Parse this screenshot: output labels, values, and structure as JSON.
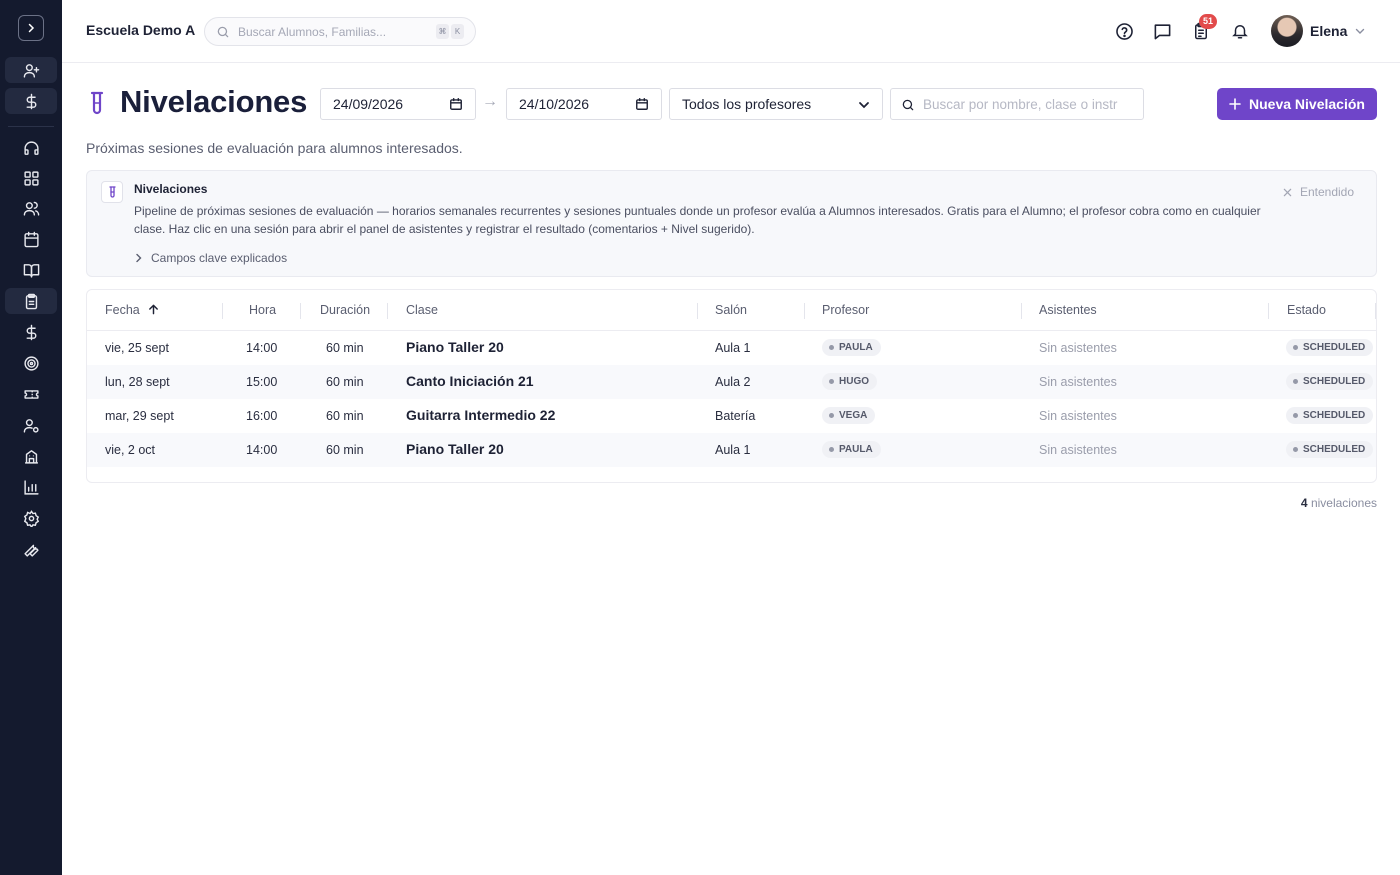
{
  "app": {
    "school_name": "Escuela Demo A",
    "search_placeholder": "Buscar Alumnos, Familias...",
    "shortcut_keys": [
      "⌘",
      "K"
    ],
    "notifications_badge": "51",
    "user_name": "Elena"
  },
  "sidebar": {
    "icons": [
      "user-plus-icon",
      "dollar-icon",
      "headset-icon",
      "grid-icon",
      "users-icon",
      "calendar-icon",
      "book-icon",
      "clipboard-icon",
      "dollar-icon",
      "target-icon",
      "ticket-icon",
      "user-gear-icon",
      "building-icon",
      "chart-icon",
      "settings-icon",
      "wrench-icon"
    ],
    "active": "clipboard-icon"
  },
  "page": {
    "title": "Nivelaciones",
    "subtitle": "Próximas sesiones de evaluación para alumnos interesados.",
    "date_from": "24/09/2026",
    "date_to": "24/10/2026",
    "date_separator": "→",
    "teacher_filter": "Todos los profesores",
    "search_placeholder": "Buscar por nombre, clase o instr",
    "new_button": "Nueva Nivelación"
  },
  "info": {
    "title": "Nivelaciones",
    "text": "Pipeline de próximas sesiones de evaluación — horarios semanales recurrentes y sesiones puntuales donde un profesor evalúa a Alumnos interesados. Gratis para el Alumno; el profesor cobra como en cualquier clase. Haz clic en una sesión para abrir el panel de asistentes y registrar el resultado (comentarios + Nivel sugerido).",
    "dismiss": "Entendido",
    "expander": "Campos clave explicados"
  },
  "table": {
    "headers": {
      "fecha": "Fecha",
      "hora": "Hora",
      "duracion": "Duración",
      "clase": "Clase",
      "salon": "Salón",
      "profesor": "Profesor",
      "asistentes": "Asistentes",
      "estado": "Estado"
    },
    "rows": [
      {
        "fecha": "vie, 25 sept",
        "hora": "14:00",
        "duracion": "60 min",
        "clase": "Piano Taller 20",
        "salon": "Aula 1",
        "profesor": "PAULA",
        "asistentes": "Sin asistentes",
        "estado": "SCHEDULED"
      },
      {
        "fecha": "lun, 28 sept",
        "hora": "15:00",
        "duracion": "60 min",
        "clase": "Canto Iniciación 21",
        "salon": "Aula 2",
        "profesor": "HUGO",
        "asistentes": "Sin asistentes",
        "estado": "SCHEDULED"
      },
      {
        "fecha": "mar, 29 sept",
        "hora": "16:00",
        "duracion": "60 min",
        "clase": "Guitarra Intermedio 22",
        "salon": "Batería",
        "profesor": "VEGA",
        "asistentes": "Sin asistentes",
        "estado": "SCHEDULED"
      },
      {
        "fecha": "vie, 2 oct",
        "hora": "14:00",
        "duracion": "60 min",
        "clase": "Piano Taller 20",
        "salon": "Aula 1",
        "profesor": "PAULA",
        "asistentes": "Sin asistentes",
        "estado": "SCHEDULED"
      }
    ]
  },
  "footer": {
    "count_value": "4",
    "count_label": "nivelaciones"
  },
  "colors": {
    "sidebar_bg": "#141a2e",
    "accent": "#6f45c9",
    "badge": "#e24b4b"
  }
}
